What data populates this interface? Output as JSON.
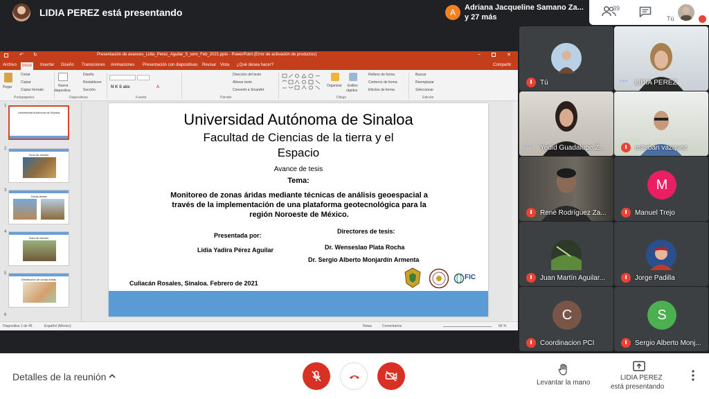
{
  "top": {
    "presenter_label": "LIDIA PEREZ está presentando",
    "notification": {
      "initial": "A",
      "name": "Adriana Jacqueline Samano Za...",
      "more": "y 27 más",
      "avatar_color": "#f4811f"
    },
    "people_count": "39",
    "self_label": "Tú"
  },
  "powerpoint": {
    "title": "Presentación de avances_Lidia_Perez_Aguilar_5_sem_Feb_2021.pptx - PowerPoint (Error de activación de productos)",
    "tabs": [
      "Archivo",
      "Inicio",
      "Insertar",
      "Diseño",
      "Transiciones",
      "Animaciones",
      "Presentación con diapositivas",
      "Revisar",
      "Vista",
      "¿Qué desea hacer?",
      "Compartir"
    ],
    "ribbon": {
      "pegar": "Pegar",
      "cortar": "Cortar",
      "copiar": "Copiar",
      "copiar_formato": "Copiar formato",
      "nueva": "Nueva",
      "diapositiva": "diapositiva",
      "diseno": "Diseño",
      "restablecer": "Restablecer",
      "seccion": "Sección",
      "direccion": "Dirección del texto",
      "alinear": "Alinear texto",
      "smartart": "Convertir a SmartArt",
      "organizar": "Organizar",
      "estilos": "Estilos",
      "rapidos": "rápidos",
      "relleno": "Relleno de forma",
      "contorno": "Contorno de forma",
      "efectos": "Efectos de forma",
      "buscar": "Buscar",
      "reemplazar": "Reemplazar",
      "seleccionar": "Seleccionar",
      "groups": [
        "Portapapeles",
        "Diapositivas",
        "Fuente",
        "Párrafo",
        "Dibujo",
        "Edición"
      ]
    },
    "thumbs": {
      "titles": [
        "Universidad Autónoma de Sinaloa",
        "Zona de estudio",
        "Zonas áridas",
        "Área de estudio",
        "Distribución de zonas áridas"
      ],
      "numbers": [
        "1",
        "2",
        "3",
        "4",
        "5",
        "6"
      ]
    },
    "slide": {
      "university": "Universidad Autónoma de Sinaloa",
      "faculty_line1": "Facultad de Ciencias de la tierra y el",
      "faculty_line2": "Espacio",
      "avance": "Avance de tesis",
      "tema": "Tema:",
      "body1": "Monitoreo de zonas áridas mediante técnicas de análisis geoespacial a",
      "body2": "través de la implementación de una plataforma geotecnológica para la",
      "body3": "región Noroeste de México.",
      "presentada": "Presentada por:",
      "directores": "Directores de tesis:",
      "presenter_name": "Lidia Yadira Pérez Aguilar",
      "director1": "Dr. Wenseslao Plata Rocha",
      "director2": "Dr. Sergio Alberto Monjardín Armenta",
      "place": "Culiacán Rosales, Sinaloa. Febrero de 2021",
      "fic": "FIC"
    },
    "status": {
      "slide_count": "Diapositiva 1 de 45",
      "language": "Español (México)",
      "notes": "Notas",
      "comments": "Comentarios",
      "zoom": "66 %"
    }
  },
  "participants": [
    {
      "name": "Tú",
      "muted": true
    },
    {
      "name": "LIDIA PEREZ",
      "muted": false
    },
    {
      "name": "Yedid Guadalupe Z...",
      "muted": false
    },
    {
      "name": "esteban vazquez",
      "muted": true
    },
    {
      "name": "René Rodríguez Za...",
      "muted": true
    },
    {
      "name": "Manuel Trejo",
      "muted": true,
      "initial": "M",
      "color": "#e91e63"
    },
    {
      "name": "Juan Martín Aguilar...",
      "muted": true
    },
    {
      "name": "Jorge Padilla",
      "muted": true
    },
    {
      "name": "Coordinacion PCI",
      "muted": true,
      "initial": "C",
      "color": "#795548"
    },
    {
      "name": "Sergio Alberto Monj...",
      "muted": true,
      "initial": "S",
      "color": "#4caf50"
    }
  ],
  "bottom": {
    "details": "Detalles de la reunión",
    "raise_hand": "Levantar la mano",
    "presenting_line1": "LIDIA PEREZ",
    "presenting_line2": "está presentando",
    "end_call_color": "#d93025"
  }
}
